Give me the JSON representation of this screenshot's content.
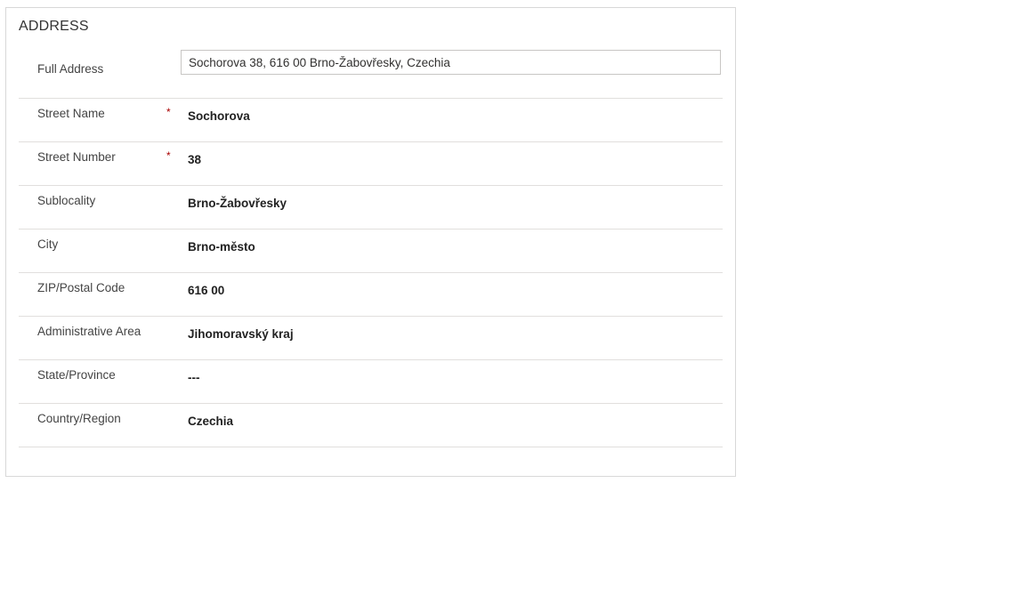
{
  "section": {
    "title": "ADDRESS"
  },
  "fields": [
    {
      "label": "Full Address",
      "value": "Sochorova 38, 616 00 Brno-Žabovřesky, Czechia",
      "required": false,
      "editable": true
    },
    {
      "label": "Street Name",
      "value": "Sochorova",
      "required": true,
      "required_mark": "*"
    },
    {
      "label": "Street Number",
      "value": "38",
      "required": true,
      "required_mark": "*"
    },
    {
      "label": "Sublocality",
      "value": "Brno-Žabovřesky",
      "required": false
    },
    {
      "label": "City",
      "value": "Brno-město",
      "required": false
    },
    {
      "label": "ZIP/Postal Code",
      "value": "616 00",
      "required": false
    },
    {
      "label": "Administrative Area",
      "value": "Jihomoravský kraj",
      "required": false
    },
    {
      "label": "State/Province",
      "value": "---",
      "required": false
    },
    {
      "label": "Country/Region",
      "value": "Czechia",
      "required": false
    }
  ],
  "colors": {
    "required": "#a80000",
    "border": "#d8d8d8",
    "divider": "#e1dfdd"
  }
}
